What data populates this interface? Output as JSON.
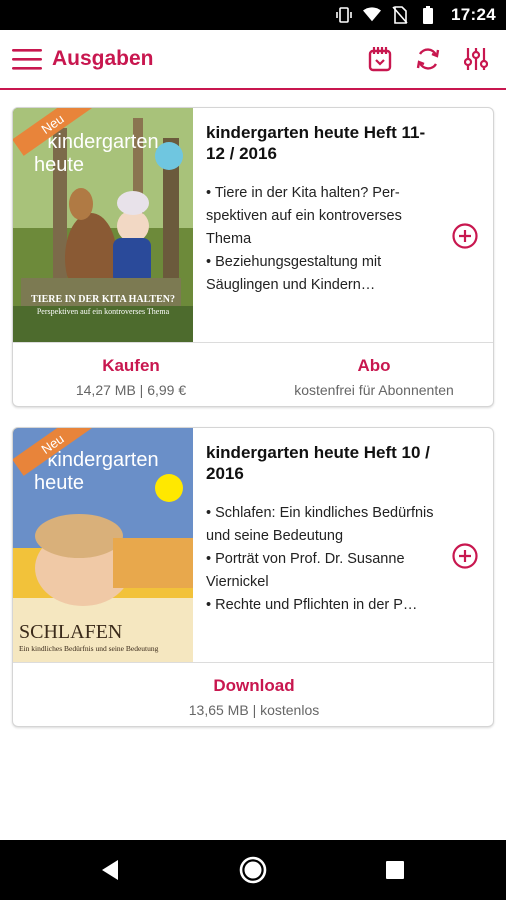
{
  "status_bar": {
    "time": "17:24"
  },
  "app_bar": {
    "title": "Ausgaben"
  },
  "colors": {
    "accent": "#c8174f",
    "badge": "#e8843a"
  },
  "issues": [
    {
      "badge": "Neu",
      "cover": {
        "masthead_top": "kindergarten",
        "masthead_bottom": "heute",
        "headline": "TIERE IN DER KITA HALTEN?",
        "subline": "Perspektiven auf ein kontroverses Thema"
      },
      "title": "kindergarten heute Heft 11-12 / 2016",
      "description": [
        "• Tiere in der Kita halten? Per- spektiven auf ein kontroverses Thema",
        "• Beziehungsgestaltung mit Säuglingen und Kindern…"
      ],
      "actions": [
        {
          "label": "Kaufen",
          "sub": "14,27 MB | 6,99 €"
        },
        {
          "label": "Abo",
          "sub": "kostenfrei für Abonnenten"
        }
      ]
    },
    {
      "badge": "Neu",
      "cover": {
        "masthead_top": "kindergarten",
        "masthead_bottom": "heute",
        "headline": "SCHLAFEN",
        "subline": "Ein kindliches Bedürfnis und seine Bedeutung"
      },
      "title": "kindergarten heute Heft 10 / 2016",
      "description": [
        "• Schlafen: Ein kindliches Bedürfnis und seine Bedeutung",
        "• Porträt von Prof. Dr. Susanne Viernickel",
        "• Rechte und Pflichten in der P…"
      ],
      "actions": [
        {
          "label": "Download",
          "sub": "13,65 MB | kostenlos"
        }
      ]
    }
  ]
}
